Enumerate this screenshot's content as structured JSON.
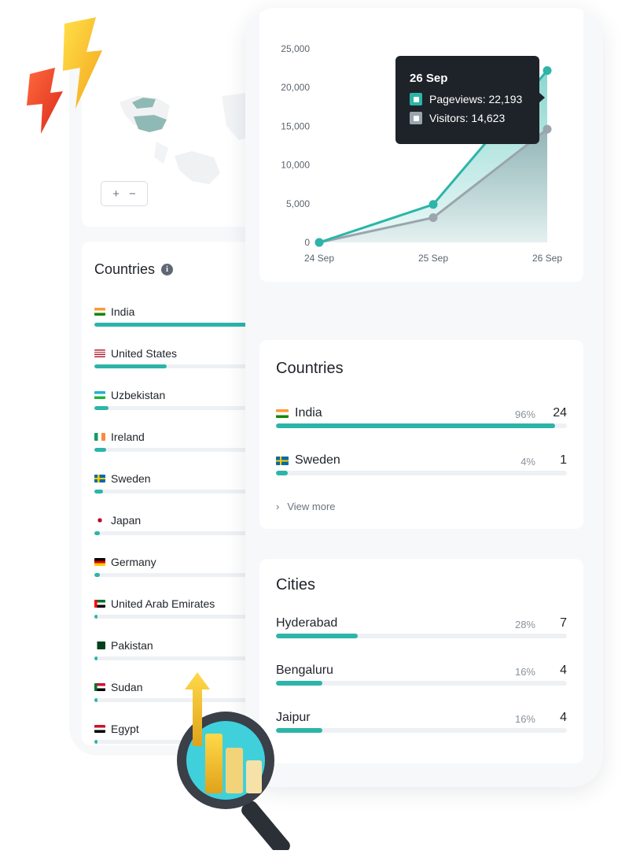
{
  "map": {
    "zoom_in": "+",
    "zoom_out": "−"
  },
  "left_countries": {
    "title": "Countries",
    "items": [
      {
        "name": "India",
        "flag": "india",
        "share": 1.0
      },
      {
        "name": "United States",
        "flag": "us",
        "share": 0.42
      },
      {
        "name": "Uzbekistan",
        "flag": "uzbekistan",
        "share": 0.08
      },
      {
        "name": "Ireland",
        "flag": "ireland",
        "share": 0.07
      },
      {
        "name": "Sweden",
        "flag": "sweden",
        "share": 0.05
      },
      {
        "name": "Japan",
        "flag": "japan",
        "share": 0.03
      },
      {
        "name": "Germany",
        "flag": "germany",
        "share": 0.03
      },
      {
        "name": "United Arab Emirates",
        "flag": "uae",
        "share": 0.02
      },
      {
        "name": "Pakistan",
        "flag": "pakistan",
        "share": 0.02
      },
      {
        "name": "Sudan",
        "flag": "sudan",
        "share": 0.02
      },
      {
        "name": "Egypt",
        "flag": "egypt",
        "share": 0.02
      }
    ]
  },
  "tooltip": {
    "date": "26 Sep",
    "pageviews": "Pageviews: 22,193",
    "visitors": "Visitors: 14,623"
  },
  "chart_data": {
    "type": "area",
    "categories": [
      "24 Sep",
      "25 Sep",
      "26 Sep"
    ],
    "ylim": [
      0,
      25000
    ],
    "yticks": [
      "0",
      "5,000",
      "10,000",
      "15,000",
      "20,000",
      "25,000"
    ],
    "series": [
      {
        "name": "Pageviews",
        "values": [
          0,
          4900,
          22193
        ],
        "color": "#2cb5a8"
      },
      {
        "name": "Visitors",
        "values": [
          0,
          3200,
          14623
        ],
        "color": "#9aa5ad"
      }
    ]
  },
  "countries": {
    "title": "Countries",
    "view_more": "View more",
    "items": [
      {
        "name": "India",
        "flag": "india",
        "pct": "96%",
        "count": "24",
        "share": 0.96
      },
      {
        "name": "Sweden",
        "flag": "sweden",
        "pct": "4%",
        "count": "1",
        "share": 0.04
      }
    ]
  },
  "cities": {
    "title": "Cities",
    "items": [
      {
        "name": "Hyderabad",
        "pct": "28%",
        "count": "7",
        "share": 0.28
      },
      {
        "name": "Bengaluru",
        "pct": "16%",
        "count": "4",
        "share": 0.16
      },
      {
        "name": "Jaipur",
        "pct": "16%",
        "count": "4",
        "share": 0.16
      }
    ]
  },
  "colors": {
    "accent": "#2cb5a8",
    "secondary": "#9aa5ad",
    "tooltip_bg": "#1e2329"
  }
}
